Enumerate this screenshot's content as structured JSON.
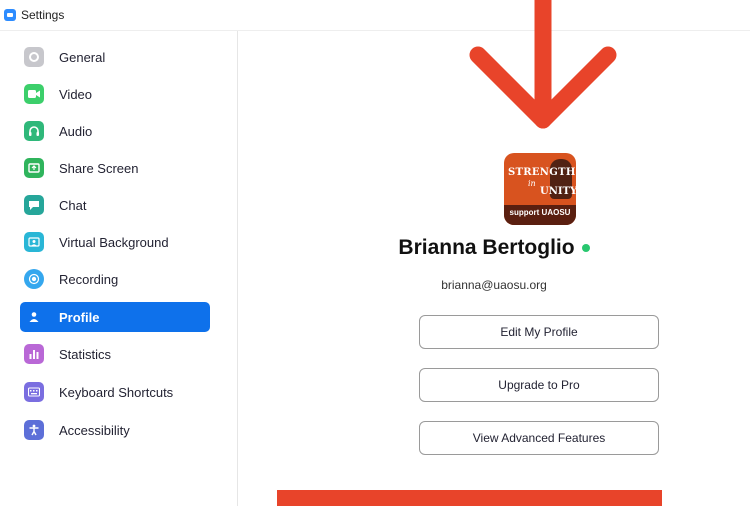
{
  "window": {
    "title": "Settings"
  },
  "sidebar": {
    "items": [
      {
        "label": "General",
        "icon": "gear-icon",
        "color": "#c7c7cc"
      },
      {
        "label": "Video",
        "icon": "video-camera-icon",
        "color": "#3ccf6b"
      },
      {
        "label": "Audio",
        "icon": "headphones-icon",
        "color": "#2fb87a"
      },
      {
        "label": "Share Screen",
        "icon": "share-screen-icon",
        "color": "#2fb45c"
      },
      {
        "label": "Chat",
        "icon": "chat-bubble-icon",
        "color": "#26a69a"
      },
      {
        "label": "Virtual Background",
        "icon": "virtual-background-icon",
        "color": "#29b6d6"
      },
      {
        "label": "Recording",
        "icon": "recording-icon",
        "color": "#35a7ee"
      },
      {
        "label": "Profile",
        "icon": "person-icon",
        "color": "#ffffff",
        "active": true
      },
      {
        "label": "Statistics",
        "icon": "bar-chart-icon",
        "color": "#b968d6"
      },
      {
        "label": "Keyboard Shortcuts",
        "icon": "keyboard-icon",
        "color": "#7a6ee0"
      },
      {
        "label": "Accessibility",
        "icon": "accessibility-icon",
        "color": "#5d6fd8"
      }
    ]
  },
  "profile": {
    "name": "Brianna Bertoglio",
    "email": "brianna@uaosu.org",
    "status_color": "#28c76f",
    "avatar": {
      "line1": "STRENGTH",
      "line2": "in",
      "line3": "UNITY",
      "band": "support UAOSU"
    }
  },
  "buttons": {
    "edit_profile": "Edit My Profile",
    "upgrade": "Upgrade to Pro",
    "advanced": "View Advanced Features"
  },
  "colors": {
    "active": "#0e71eb",
    "annotation": "#e8442a"
  }
}
